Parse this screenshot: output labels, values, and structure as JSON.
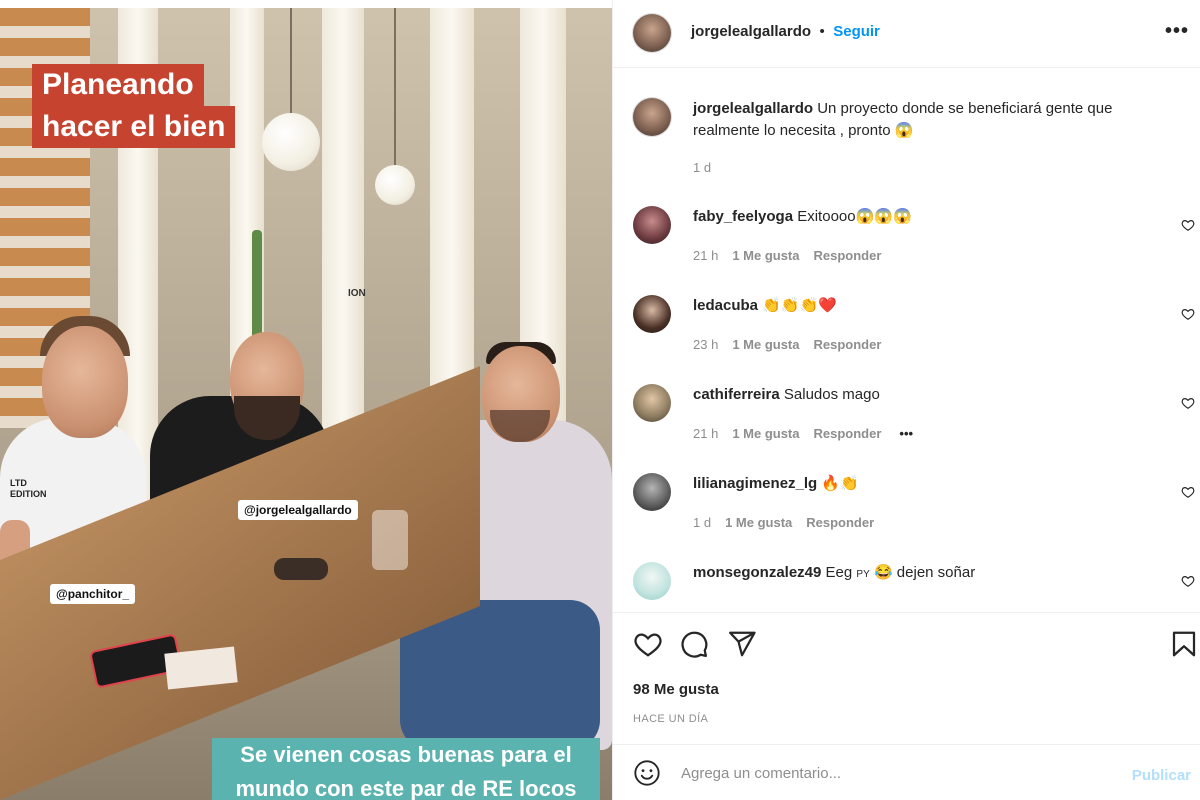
{
  "photo": {
    "headline_line1": "Planeando",
    "headline_line2": "hacer el bien",
    "tag_center": "@jorgelealgallardo",
    "tag_left": "@panchitor_",
    "caption_line1": "Se vienen cosas buenas para el",
    "caption_line2": "mundo con este par de RE locos",
    "sign_text": "ION",
    "shirt_text": "LTD EDITION"
  },
  "header": {
    "username": "jorgelealgallardo",
    "separator": "•",
    "follow_label": "Seguir",
    "more_label": "•••"
  },
  "caption": {
    "username": "jorgelealgallardo",
    "text": "Un proyecto donde se beneficiará gente que realmente lo necesita , pronto",
    "emoji": "😱",
    "time": "1 d"
  },
  "comments": [
    {
      "username": "faby_feelyoga",
      "text": "Exitoooo",
      "emoji": "😱😱😱",
      "time": "21 h",
      "likes": "1 Me gusta",
      "reply": "Responder"
    },
    {
      "username": "ledacuba",
      "text": "",
      "emoji": "👏👏👏❤️",
      "time": "23 h",
      "likes": "1 Me gusta",
      "reply": "Responder"
    },
    {
      "username": "cathiferreira",
      "text": "Saludos mago",
      "emoji": "",
      "time": "21 h",
      "likes": "1 Me gusta",
      "reply": "Responder",
      "more": "•••"
    },
    {
      "username": "lilianagimenez_lg",
      "text": "",
      "emoji": "🔥👏",
      "time": "1 d",
      "likes": "1 Me gusta",
      "reply": "Responder"
    },
    {
      "username": "monsegonzalez49",
      "text": "Eeg",
      "flag": "PY",
      "emoji": "😂",
      "text_after": "dejen soñar"
    }
  ],
  "actions": {
    "like_icon": "heart-icon",
    "comment_icon": "comment-icon",
    "share_icon": "send-icon",
    "save_icon": "bookmark-icon",
    "likes": "98 Me gusta",
    "when": "HACE UN DÍA"
  },
  "add_comment": {
    "placeholder": "Agrega un comentario...",
    "publish_label": "Publicar",
    "emoji_icon": "smiley-icon"
  },
  "colors": {
    "accent": "#0095f6",
    "publish_disabled": "#b2dffc",
    "headline_bg": "#c5432f",
    "caption_bg": "#5bb3b0",
    "heart_red": "#ed4956"
  }
}
